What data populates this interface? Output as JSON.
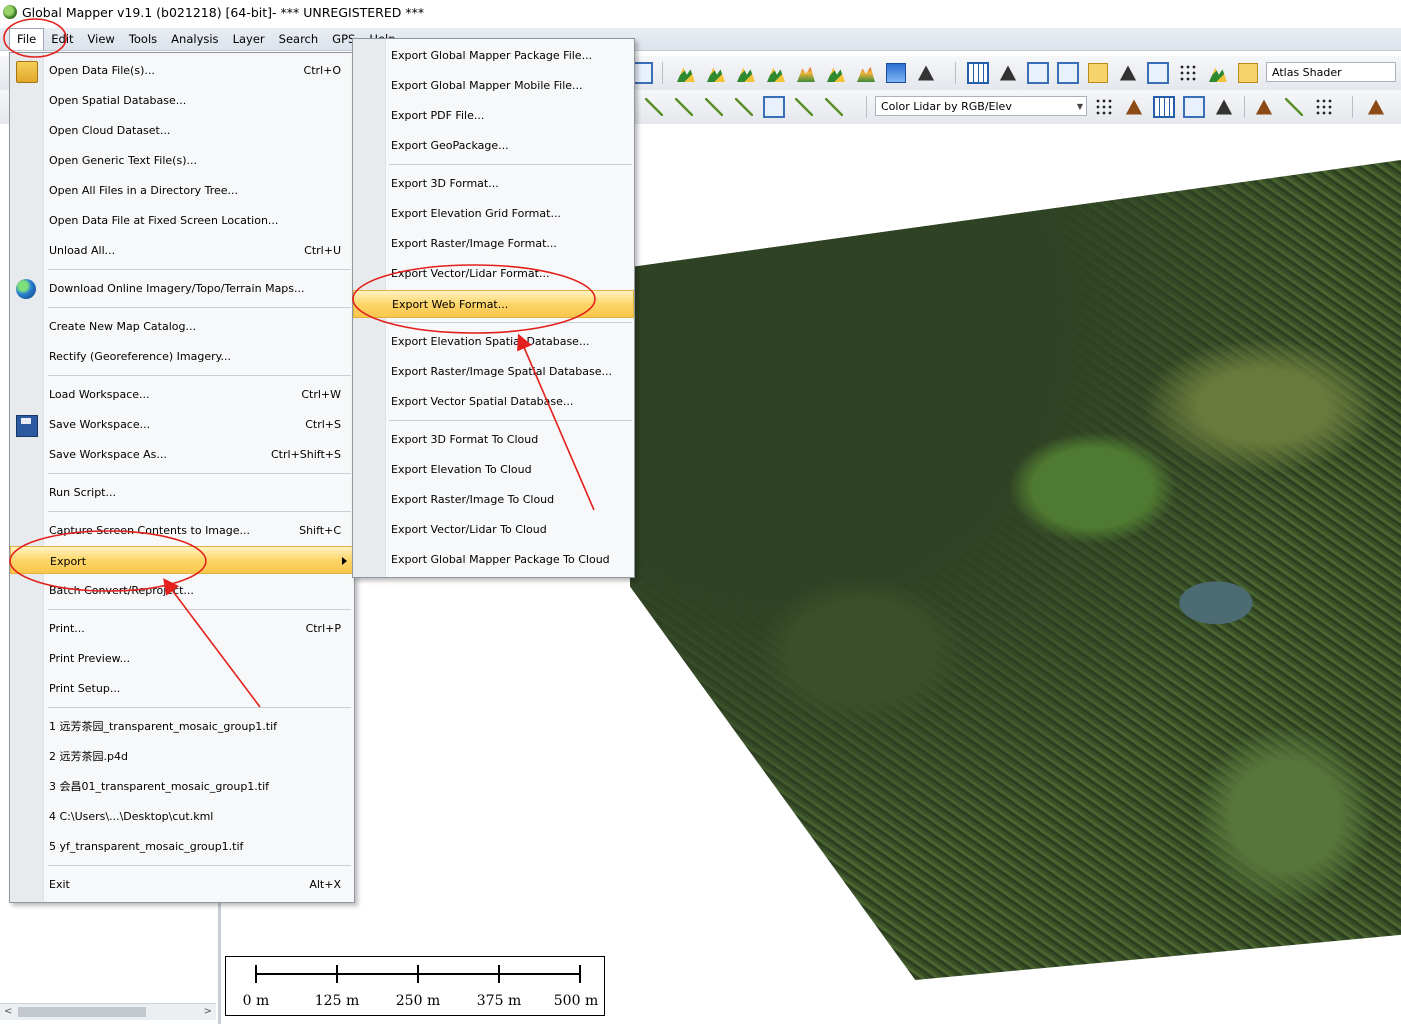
{
  "window": {
    "title": "Global Mapper v19.1 (b021218) [64-bit]- *** UNREGISTERED ***"
  },
  "menubar": [
    "File",
    "Edit",
    "View",
    "Tools",
    "Analysis",
    "Layer",
    "Search",
    "GPS",
    "Help"
  ],
  "toolbar": {
    "shader_combo": "Atlas Shader",
    "lidar_combo": "Color Lidar by RGB/Elev"
  },
  "file_menu": {
    "items": [
      {
        "label": "Open Data File(s)...",
        "shortcut": "Ctrl+O",
        "icon": "folder-icon"
      },
      {
        "label": "Open Spatial Database...",
        "shortcut": ""
      },
      {
        "label": "Open Cloud Dataset...",
        "shortcut": ""
      },
      {
        "label": "Open Generic Text File(s)...",
        "shortcut": ""
      },
      {
        "label": "Open All Files in a Directory Tree...",
        "shortcut": ""
      },
      {
        "label": "Open Data File at Fixed Screen Location...",
        "shortcut": ""
      },
      {
        "label": "Unload All...",
        "shortcut": "Ctrl+U"
      },
      {
        "label": "Download Online Imagery/Topo/Terrain Maps...",
        "shortcut": "",
        "icon": "globe-icon"
      },
      {
        "label": "Create New Map Catalog...",
        "shortcut": ""
      },
      {
        "label": "Rectify (Georeference) Imagery...",
        "shortcut": ""
      },
      {
        "label": "Load Workspace...",
        "shortcut": "Ctrl+W"
      },
      {
        "label": "Save Workspace...",
        "shortcut": "Ctrl+S",
        "icon": "save-icon"
      },
      {
        "label": "Save Workspace As...",
        "shortcut": "Ctrl+Shift+S"
      },
      {
        "label": "Run Script...",
        "shortcut": ""
      },
      {
        "label": "Capture Screen Contents to Image...",
        "shortcut": "Shift+C"
      },
      {
        "label": "Export",
        "shortcut": ""
      },
      {
        "label": "Batch Convert/Reproject...",
        "shortcut": ""
      },
      {
        "label": "Print...",
        "shortcut": "Ctrl+P"
      },
      {
        "label": "Print Preview...",
        "shortcut": ""
      },
      {
        "label": "Print Setup...",
        "shortcut": ""
      },
      {
        "label": "1 远芳茶园_transparent_mosaic_group1.tif",
        "shortcut": ""
      },
      {
        "label": "2 远芳茶园.p4d",
        "shortcut": ""
      },
      {
        "label": "3 会昌01_transparent_mosaic_group1.tif",
        "shortcut": ""
      },
      {
        "label": "4 C:\\Users\\...\\Desktop\\cut.kml",
        "shortcut": ""
      },
      {
        "label": "5 yf_transparent_mosaic_group1.tif",
        "shortcut": ""
      },
      {
        "label": "Exit",
        "shortcut": "Alt+X"
      }
    ]
  },
  "export_submenu": {
    "items": [
      "Export Global Mapper Package File...",
      "Export Global Mapper Mobile File...",
      "Export PDF File...",
      "Export GeoPackage...",
      "Export 3D Format...",
      "Export Elevation Grid Format...",
      "Export Raster/Image Format...",
      "Export Vector/Lidar Format...",
      "Export Web Format...",
      "Export Elevation Spatial Database...",
      "Export Raster/Image Spatial Database...",
      "Export Vector Spatial Database...",
      "Export 3D Format To Cloud",
      "Export Elevation To Cloud",
      "Export Raster/Image To Cloud",
      "Export Vector/Lidar To Cloud",
      "Export Global Mapper Package To Cloud"
    ]
  },
  "scalebar": {
    "labels": [
      "0 m",
      "125 m",
      "250 m",
      "375 m",
      "500 m"
    ]
  },
  "colors": {
    "highlight": "#fdd66a",
    "annotation": "#e3201b",
    "menubar": "#e3e8ef"
  }
}
